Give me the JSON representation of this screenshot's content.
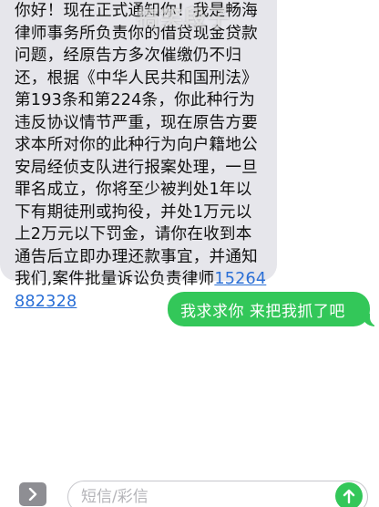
{
  "colors": {
    "incoming_bubble": "#e6e6eb",
    "outgoing_bubble": "#33c759",
    "link": "#2a6fd6",
    "send_button": "#33c759"
  },
  "messages": {
    "incoming": {
      "text": "你好！现在正式通知你！我是畅海律师事务所负责你的借贷现金贷款问题，经原告方多次催缴仍不归还，根据《中华人民共和国刑法》第193条和第224条，你此种行为违反协议情节严重，现在原告方要求本所对你的此种行为向户籍地公安局经侦支队进行报案处理，一旦罪名成立，你将至少被判处1年以下有期徒刑或拘役，并处1万元以上2万元以下罚金，请你在收到本通告后立即办理还款事宜，并通知我们,案件批量诉讼负责律师",
      "phone": "15264882328"
    },
    "outgoing": {
      "text": "我求求你 来把我抓了吧"
    }
  },
  "watermark": {
    "text": "搞笑段子"
  },
  "composer": {
    "placeholder": "短信/彩信",
    "value": "",
    "expand_icon": "chevron-right-icon",
    "send_icon": "arrow-up-icon"
  }
}
